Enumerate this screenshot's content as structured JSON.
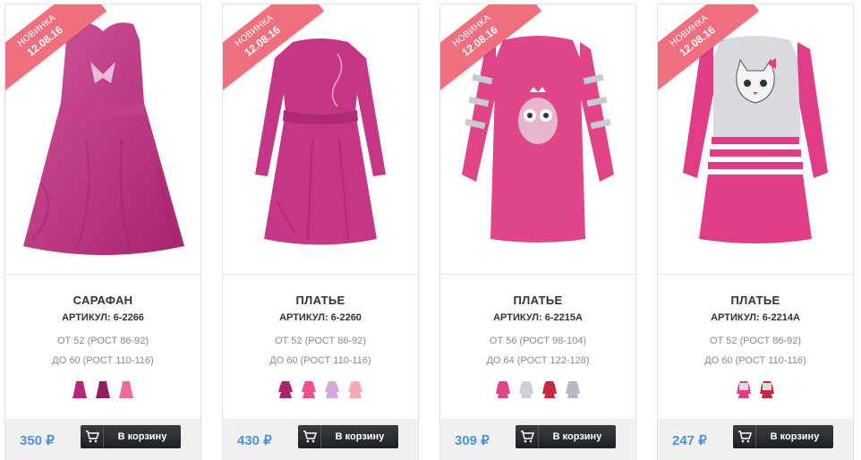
{
  "colors": {
    "accent_price": "#4f93d6",
    "ribbon": "#ef6f7f",
    "button": "#25292d"
  },
  "products": [
    {
      "ribbon": {
        "label": "НОВИНКА",
        "date": "12.08.16"
      },
      "title": "САРАФАН",
      "sku": "АРТИКУЛ: 6-2266",
      "size_from": "ОТ 52 (РОСТ 86-92)",
      "size_to": "ДО 60 (РОСТ 110-116)",
      "price": "350 ₽",
      "cart_label": "В корзину",
      "icon": "cart-icon"
    },
    {
      "ribbon": {
        "label": "НОВИНКА",
        "date": "12.08.16"
      },
      "title": "ПЛАТЬЕ",
      "sku": "АРТИКУЛ: 6-2260",
      "size_from": "ОТ 52 (РОСТ 86-92)",
      "size_to": "ДО 60 (РОСТ 110-116)",
      "price": "430 ₽",
      "cart_label": "В корзину",
      "icon": "cart-icon"
    },
    {
      "ribbon": {
        "label": "НОВИНКА",
        "date": "12.08.16"
      },
      "title": "ПЛАТЬЕ",
      "sku": "АРТИКУЛ: 6-2215А",
      "size_from": "ОТ 56 (РОСТ 98-104)",
      "size_to": "ДО 64 (РОСТ 122-128)",
      "price": "309 ₽",
      "cart_label": "В корзину",
      "icon": "cart-icon"
    },
    {
      "ribbon": {
        "label": "НОВИНКА",
        "date": "12.08.16"
      },
      "title": "ПЛАТЬЕ",
      "sku": "АРТИКУЛ: 6-2214А",
      "size_from": "ОТ 52 (РОСТ 86-92)",
      "size_to": "ДО 60 (РОСТ 110-116)",
      "price": "247 ₽",
      "cart_label": "В корзину",
      "icon": "cart-icon"
    }
  ]
}
